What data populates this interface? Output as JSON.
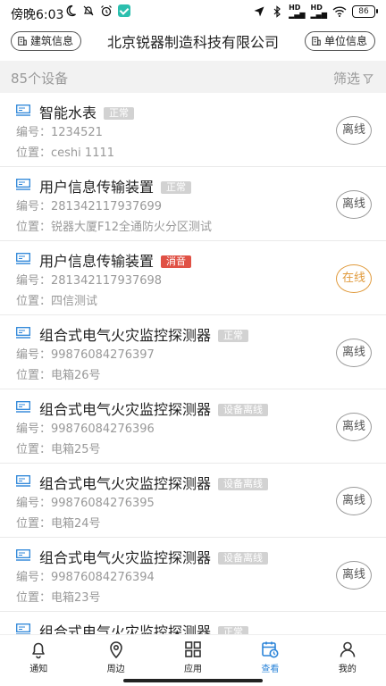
{
  "status_bar": {
    "time": "傍晚6:03",
    "battery": "86"
  },
  "header": {
    "left_button": "建筑信息",
    "title": "北京锐器制造科技有限公司",
    "right_button": "单位信息"
  },
  "subheader": {
    "count": "85个设备",
    "filter": "筛选"
  },
  "devices": [
    {
      "name": "智能水表",
      "badge": "正常",
      "badge_color": "#d2d2d2",
      "id_label": "编号：",
      "id": "1234521",
      "loc_label": "位置：",
      "location": "ceshi 1111",
      "state": "离线"
    },
    {
      "name": "用户信息传输装置",
      "badge": "正常",
      "badge_color": "#d2d2d2",
      "id_label": "编号：",
      "id": "281342117937699",
      "loc_label": "位置：",
      "location": "锐器大厦F12全通防火分区测试",
      "state": "离线"
    },
    {
      "name": "用户信息传输装置",
      "badge": "消音",
      "badge_color": "#e05145",
      "id_label": "编号：",
      "id": "281342117937698",
      "loc_label": "位置：",
      "location": "四信测试",
      "state": "在线"
    },
    {
      "name": "组合式电气火灾监控探测器",
      "badge": "正常",
      "badge_color": "#d2d2d2",
      "id_label": "编号：",
      "id": "99876084276397",
      "loc_label": "位置：",
      "location": "电箱26号",
      "state": "离线"
    },
    {
      "name": "组合式电气火灾监控探测器",
      "badge": "设备离线",
      "badge_color": "#d2d2d2",
      "id_label": "编号：",
      "id": "99876084276396",
      "loc_label": "位置：",
      "location": "电箱25号",
      "state": "离线"
    },
    {
      "name": "组合式电气火灾监控探测器",
      "badge": "设备离线",
      "badge_color": "#d2d2d2",
      "id_label": "编号：",
      "id": "99876084276395",
      "loc_label": "位置：",
      "location": "电箱24号",
      "state": "离线"
    },
    {
      "name": "组合式电气火灾监控探测器",
      "badge": "设备离线",
      "badge_color": "#d2d2d2",
      "id_label": "编号：",
      "id": "99876084276394",
      "loc_label": "位置：",
      "location": "电箱23号",
      "state": "离线"
    },
    {
      "name": "组合式电气火灾监控探测器",
      "badge": "正常",
      "badge_color": "#d2d2d2",
      "id_label": "",
      "id": "",
      "loc_label": "",
      "location": "",
      "state": ""
    }
  ],
  "tabs": [
    {
      "label": "通知",
      "icon": "bell-icon"
    },
    {
      "label": "周边",
      "icon": "location-pin-icon"
    },
    {
      "label": "应用",
      "icon": "grid-icon"
    },
    {
      "label": "查看",
      "icon": "calendar-clock-icon",
      "active": true
    },
    {
      "label": "我的",
      "icon": "user-icon"
    }
  ],
  "colors": {
    "accent": "#2b84d8",
    "alarm": "#e05145",
    "online": "#e09a3c"
  }
}
